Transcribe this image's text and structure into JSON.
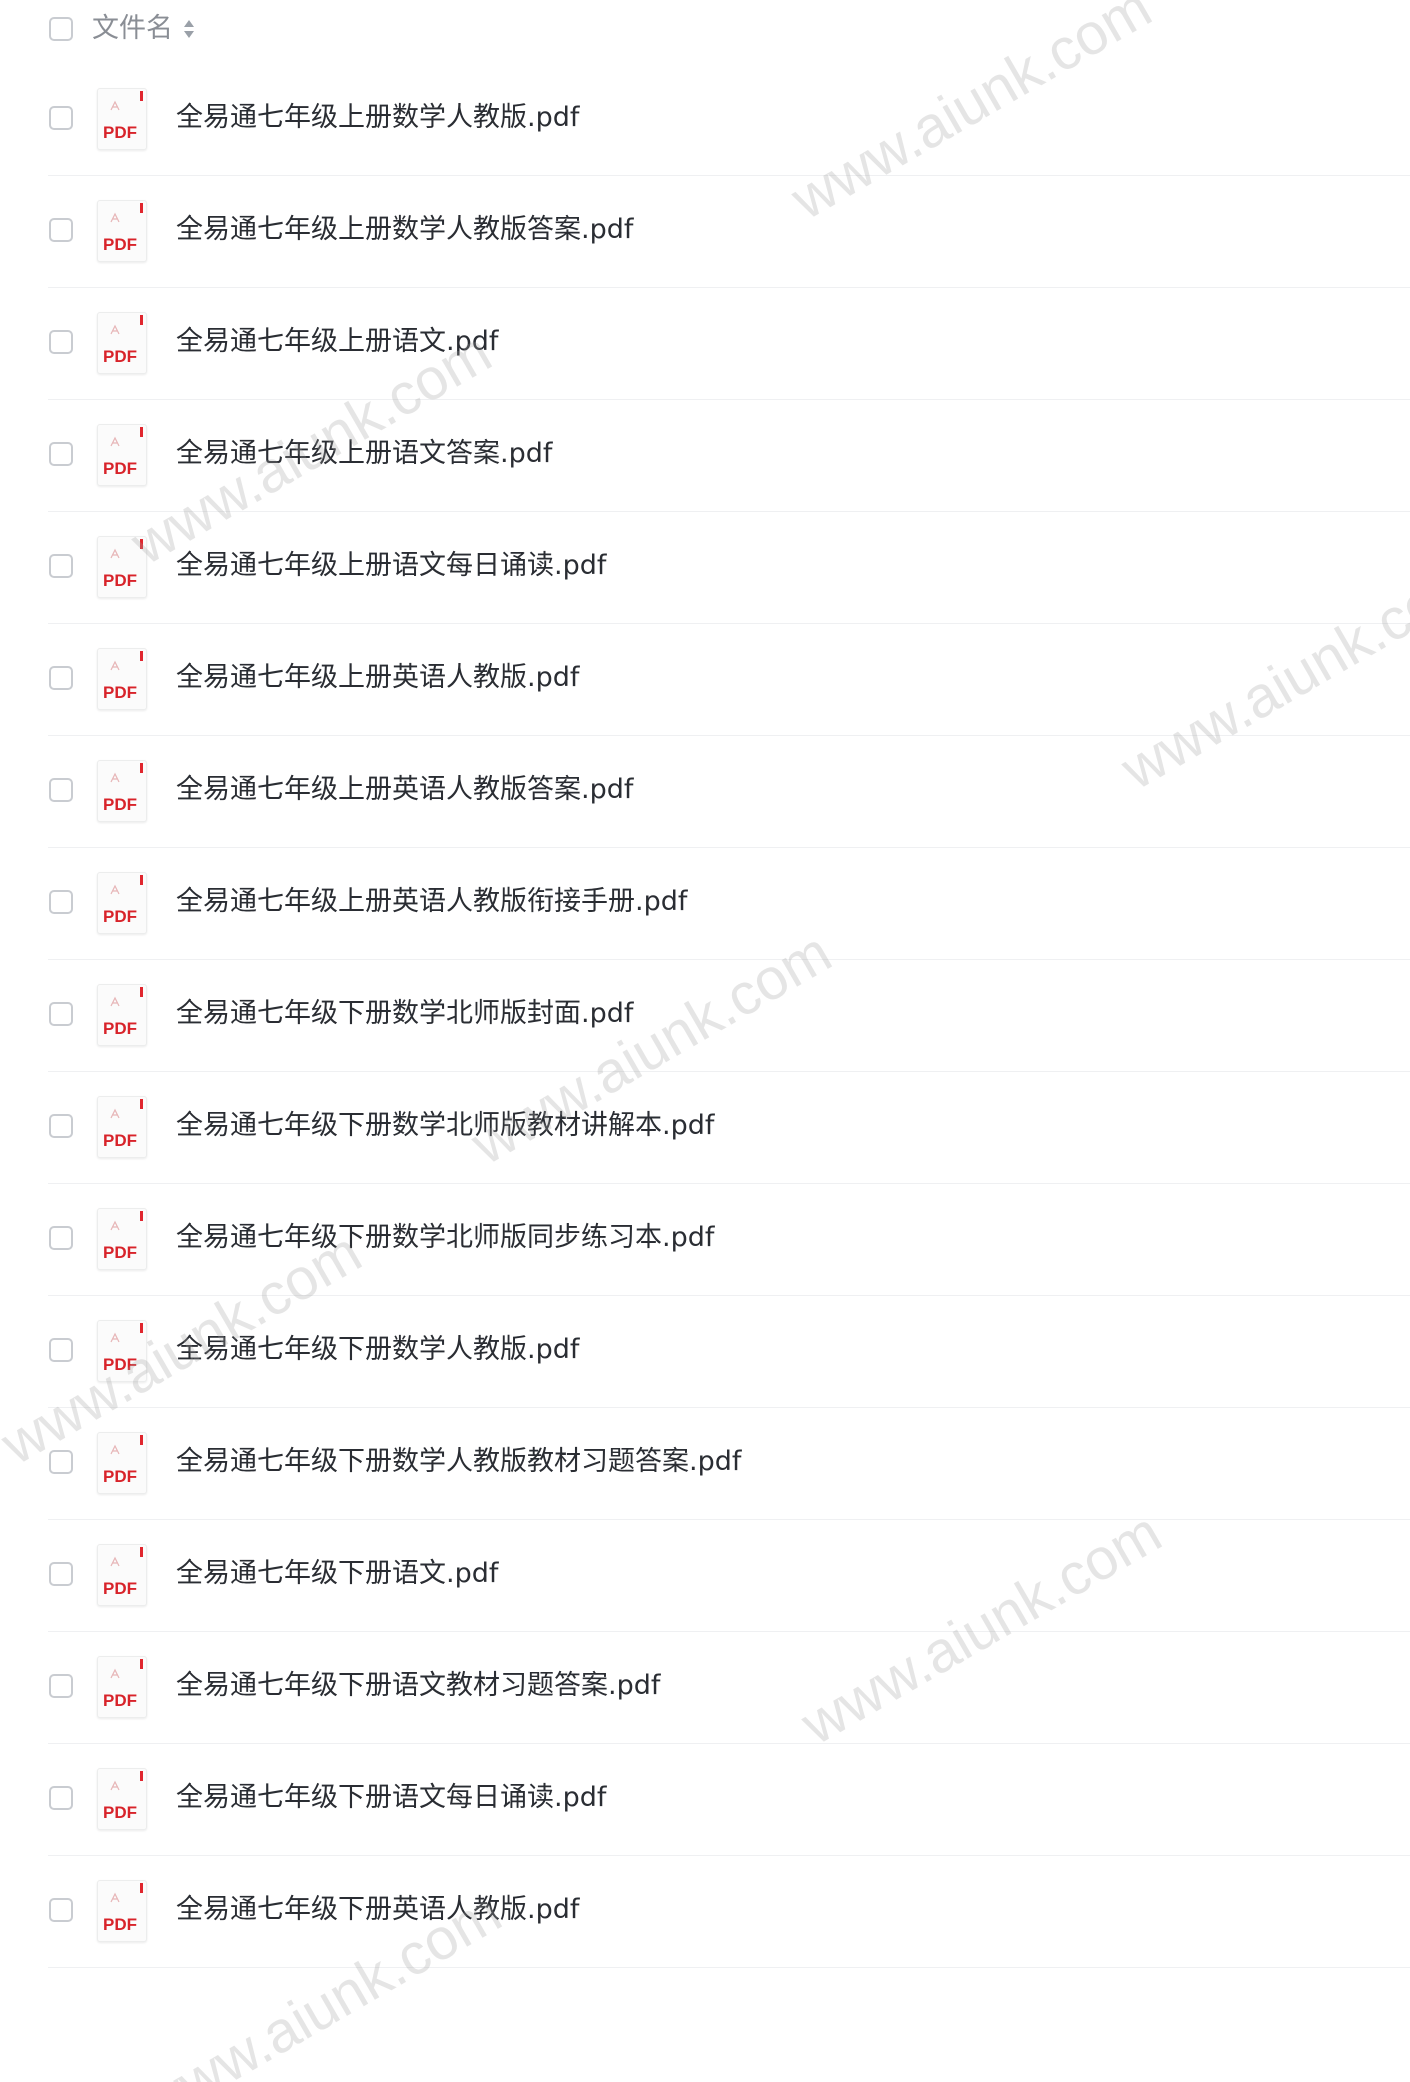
{
  "header": {
    "column_label": "文件名",
    "sort_icon": "sort-updown-icon"
  },
  "file_icon": {
    "name": "pdf-file-icon",
    "label": "PDF",
    "accent_color": "#d8232a"
  },
  "files": [
    "全易通七年级上册数学人教版.pdf",
    "全易通七年级上册数学人教版答案.pdf",
    "全易通七年级上册语文.pdf",
    "全易通七年级上册语文答案.pdf",
    "全易通七年级上册语文每日诵读.pdf",
    "全易通七年级上册英语人教版.pdf",
    "全易通七年级上册英语人教版答案.pdf",
    "全易通七年级上册英语人教版衔接手册.pdf",
    "全易通七年级下册数学北师版封面.pdf",
    "全易通七年级下册数学北师版教材讲解本.pdf",
    "全易通七年级下册数学北师版同步练习本.pdf",
    "全易通七年级下册数学人教版.pdf",
    "全易通七年级下册数学人教版教材习题答案.pdf",
    "全易通七年级下册语文.pdf",
    "全易通七年级下册语文教材习题答案.pdf",
    "全易通七年级下册语文每日诵读.pdf",
    "全易通七年级下册英语人教版.pdf"
  ],
  "watermark_text": "www.aiunk.com"
}
